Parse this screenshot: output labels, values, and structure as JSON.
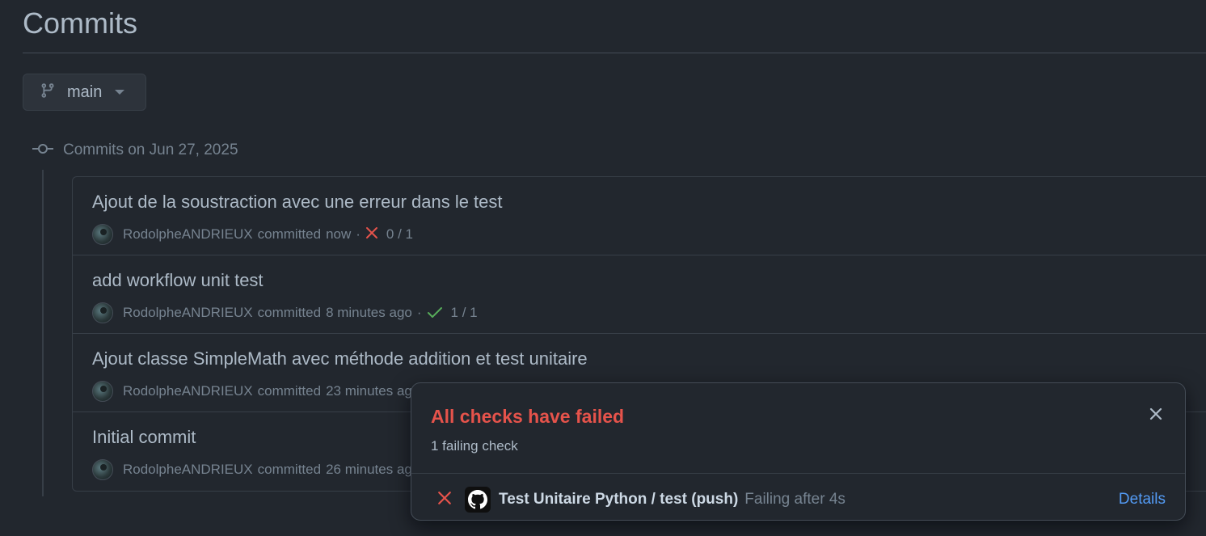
{
  "page": {
    "title": "Commits"
  },
  "branch": {
    "label": "main"
  },
  "group": {
    "label": "Commits on Jun 27, 2025"
  },
  "commits": [
    {
      "message": "Ajout de la soustraction avec une erreur dans le test",
      "author": "RodolpheANDRIEUX",
      "action": "committed",
      "time": "now",
      "status": "failed",
      "checks": "0 / 1"
    },
    {
      "message": "add workflow unit test",
      "author": "RodolpheANDRIEUX",
      "action": "committed",
      "time": "8 minutes ago",
      "status": "success",
      "checks": "1 / 1"
    },
    {
      "message": "Ajout classe SimpleMath avec méthode addition et test unitaire",
      "author": "RodolpheANDRIEUX",
      "action": "committed",
      "time": "23 minutes ago",
      "status": "",
      "checks": ""
    },
    {
      "message": "Initial commit",
      "author": "RodolpheANDRIEUX",
      "action": "committed",
      "time": "26 minutes ago",
      "status": "",
      "checks": ""
    }
  ],
  "popover": {
    "title": "All checks have failed",
    "subtitle": "1 failing check",
    "check": {
      "name": "Test Unitaire Python / test (push)",
      "status": "Failing after 4s",
      "details_label": "Details"
    }
  },
  "colors": {
    "background": "#22272e",
    "danger": "#e5534b",
    "success": "#57ab5a",
    "link": "#539bf5"
  },
  "icons": [
    "git-branch-icon",
    "caret-down-icon",
    "git-commit-icon",
    "x-icon",
    "check-icon",
    "close-icon",
    "github-logo-icon"
  ]
}
